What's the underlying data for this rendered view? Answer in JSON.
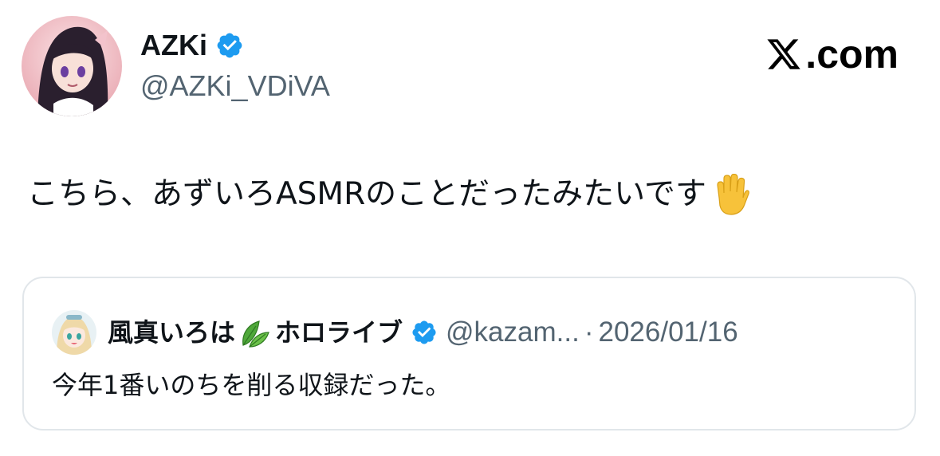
{
  "author": {
    "name": "AZKi",
    "handle": "@AZKi_VDiVA",
    "verified": true
  },
  "brand": {
    "label": ".com",
    "logo_icon": "x-logo-icon"
  },
  "tweet": {
    "text": "こちら、あずいろASMRのことだったみたいです",
    "emoji": "raised-hand-icon"
  },
  "quoted_tweet": {
    "author_name": "風真いろは",
    "author_emoji": "leaf-icon",
    "author_org": "ホロライブ",
    "verified": true,
    "handle": "@kazam...",
    "separator": "·",
    "date": "2026/01/16",
    "text": "今年1番いのちを削る収録だった。"
  },
  "colors": {
    "verified_badge": "#1d9bf0",
    "secondary_text": "#536471",
    "border": "#e1e6ea",
    "leaf_green": "#3a8d2f",
    "hand_emoji": "#f7c23a"
  }
}
